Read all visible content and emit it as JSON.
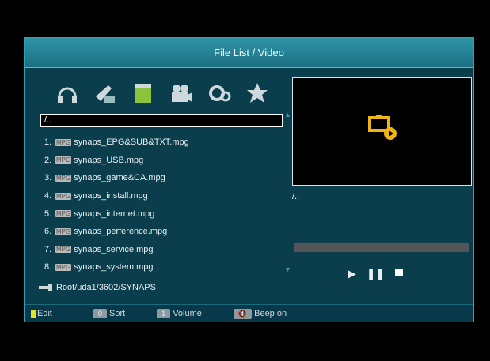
{
  "window": {
    "title": "File List / Video"
  },
  "tabs": [
    {
      "icon": "music-headphones-icon"
    },
    {
      "icon": "paint-icon"
    },
    {
      "icon": "clapperboard-icon"
    },
    {
      "icon": "camera-icon"
    },
    {
      "icon": "gear-icon"
    },
    {
      "icon": "download-icon"
    }
  ],
  "path_field": {
    "value": "/.."
  },
  "files": [
    {
      "num": "1.",
      "type": "MPG",
      "name": "synaps_EPG&SUB&TXT.mpg"
    },
    {
      "num": "2.",
      "type": "MPG",
      "name": "synaps_USB.mpg"
    },
    {
      "num": "3.",
      "type": "MPG",
      "name": "synaps_game&CA.mpg"
    },
    {
      "num": "4.",
      "type": "MPG",
      "name": "synaps_install.mpg"
    },
    {
      "num": "5.",
      "type": "MPG",
      "name": "synaps_internet.mpg"
    },
    {
      "num": "6.",
      "type": "MPG",
      "name": "synaps_perference.mpg"
    },
    {
      "num": "7.",
      "type": "MPG",
      "name": "synaps_service.mpg"
    },
    {
      "num": "8.",
      "type": "MPG",
      "name": "synaps_system.mpg"
    }
  ],
  "current_path": "Root/uda1/3602/SYNAPS",
  "preview": {
    "path": "/..",
    "progress": 0.0
  },
  "bottom": {
    "edit_label": "Edit",
    "sort_key": "0",
    "sort_label": "Sort",
    "volume_key": "1",
    "volume_label": "Volume",
    "beep_label": "Beep on"
  },
  "colors": {
    "accent": "#2f95a8",
    "panel": "#0b3e4c",
    "yellow": "#e3e12a",
    "orange": "#f0b514"
  }
}
